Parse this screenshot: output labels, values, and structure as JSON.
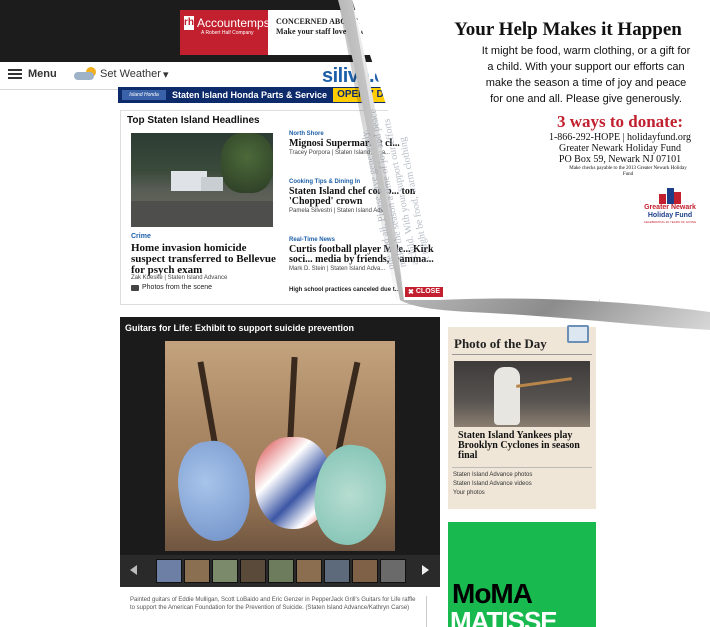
{
  "ad_top": {
    "brand": "Accountemps",
    "brand_sub": "A Robert Half Company",
    "headline": "CONCERNED ABOUT RE...",
    "subline": "Make your staff love the c..."
  },
  "nav": {
    "menu_label": "Menu",
    "weather_label": "Set Weather",
    "logo": "silive.co"
  },
  "banner": {
    "logo_text": "Island Honda",
    "text": "Staten Island Honda Parts & Service",
    "cta": "OPEN 7 DAYS"
  },
  "headlines": {
    "title": "Top Staten Island Headlines",
    "lead": {
      "category": "Crime",
      "title": "Home invasion homicide suspect transferred to Bellevue for psych exam",
      "byline": "Zak Koeske |  Staten Island Advance",
      "photos": "Photos from the scene"
    },
    "stories": [
      {
        "category": "North Shore",
        "title": "Mignosi Supermarket cl... 'gourmet' market comin...",
        "byline": "Tracey Porpora |  Staten Island Adva..."
      },
      {
        "category": "Cooking Tips & Dining In",
        "title": "Staten Island chef comp... tonight for Food Networ... 'Chopped' crown",
        "byline": "Pamela Silvestri |  Staten Island Adva..."
      },
      {
        "category": "Real-Time News",
        "title": "Curtis football player Mile... Kirkland mourned on soci... media by friends, teamma...",
        "byline": "Mark D. Stein |  Staten Island Adva..."
      }
    ],
    "more": "High school practices canceled due t...",
    "close_label": "CLOSE"
  },
  "gallery": {
    "title": "Guitars for Life: Exhibit to support suicide prevention",
    "caption": "Painted guitars of Eddie Mulligan, Scott LoBaido and Eric Genzer in PepperJack Grill's Guitars for Life raffle to support the American Foundation for the Prevention of Suicide. (Staten Island Advance/Kathryn Carse)"
  },
  "photo_of_day": {
    "title": "Photo of the Day",
    "caption": "Staten Island Yankees play Brooklyn Cyclones in season final",
    "links": [
      "Staten Island Advance photos",
      "Staten Island Advance videos",
      "Your photos"
    ]
  },
  "moma_ad": {
    "line1": "MoMA",
    "line2": "MATISSE"
  },
  "holiday_fund": {
    "headline": "Your Help Makes it Happen",
    "body": "It might be food, warm clothing, or a gift for a child. With your support our efforts can make the season a time of joy and peace for one and all. Please give generously.",
    "ways": "3 ways to donate:",
    "phone_web": "1-866-292-HOPE | holidayfund.org",
    "org": "Greater Newark Holiday Fund",
    "po_box": "PO Box 59, Newark NJ 07101",
    "checks": "Make checks payable to the 2013 Greater Newark Holiday Fund",
    "logo_line1": "Greater Newark",
    "logo_line2": "Holiday Fund",
    "logo_tag": "CELEBRATING 20 YEARS OF GIVING"
  },
  "colors": {
    "accent_red": "#c2202e",
    "link_blue": "#1d5fa8",
    "moma_green": "#18ba4f"
  }
}
